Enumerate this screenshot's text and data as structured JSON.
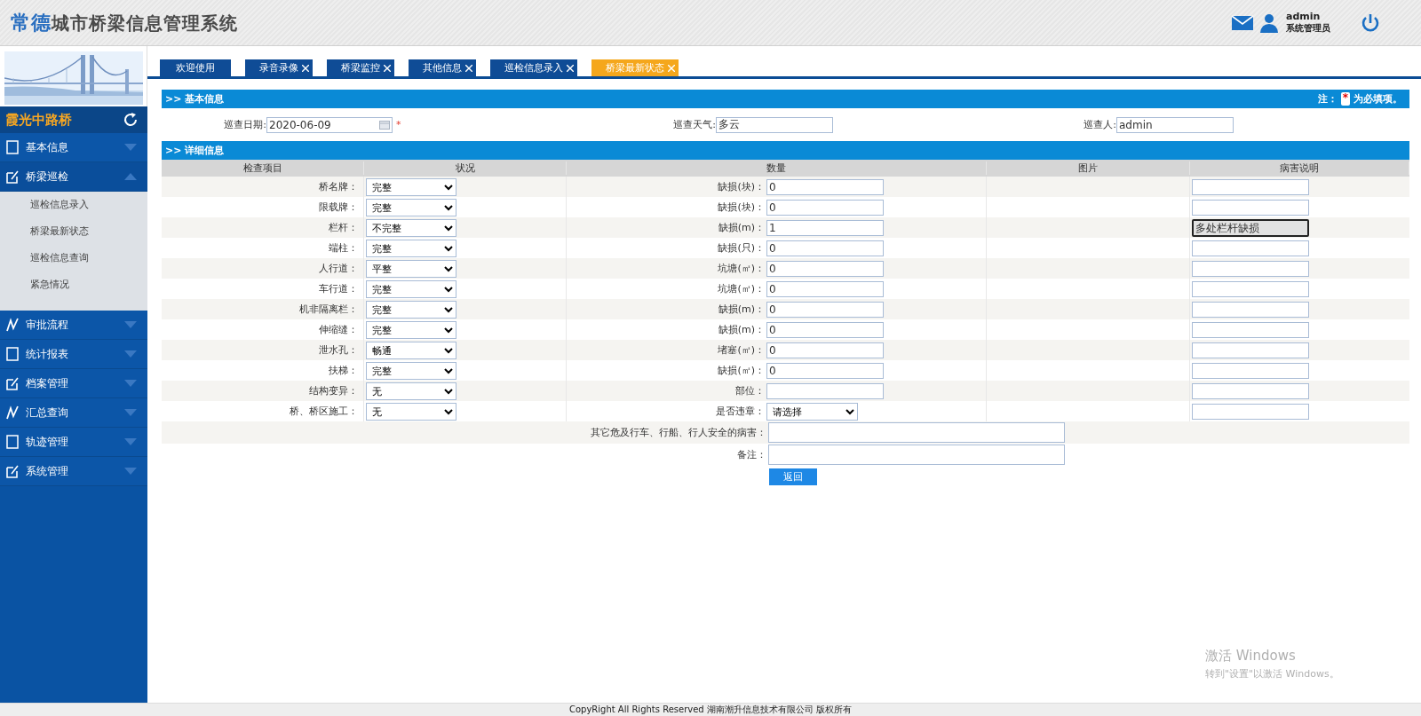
{
  "header": {
    "logo_city": "常德",
    "logo_rest": "城市桥梁信息管理系统",
    "user": {
      "name": "admin",
      "role": "系统管理员"
    }
  },
  "sidebar": {
    "bridge_name": "霞光中路桥",
    "menu": [
      {
        "label": "基本信息",
        "expanded": false
      },
      {
        "label": "桥梁巡检",
        "expanded": true,
        "children": [
          {
            "label": "巡检信息录入",
            "selected": false
          },
          {
            "label": "桥梁最新状态",
            "selected": false
          },
          {
            "label": "巡检信息查询",
            "selected": false
          },
          {
            "label": "紧急情况",
            "selected": false
          }
        ]
      },
      {
        "label": "审批流程",
        "expanded": false
      },
      {
        "label": "统计报表",
        "expanded": false
      },
      {
        "label": "档案管理",
        "expanded": false
      },
      {
        "label": "汇总查询",
        "expanded": false
      },
      {
        "label": "轨迹管理",
        "expanded": false
      },
      {
        "label": "系统管理",
        "expanded": false
      }
    ]
  },
  "tabs": [
    {
      "label": "欢迎使用",
      "selected": false,
      "closable": false
    },
    {
      "label": "录音录像",
      "selected": false,
      "closable": true
    },
    {
      "label": "桥梁监控",
      "selected": false,
      "closable": true
    },
    {
      "label": "其他信息",
      "selected": false,
      "closable": true
    },
    {
      "label": "巡检信息录入",
      "selected": false,
      "closable": true
    },
    {
      "label": "桥梁最新状态",
      "selected": true,
      "closable": true
    }
  ],
  "basic_info": {
    "title": ">> 基本信息",
    "note_prefix": "注：",
    "required_mark": "*",
    "note_suffix": "为必填项。",
    "fields": [
      {
        "label": "巡查日期:",
        "value": "2020-06-09",
        "kind": "date",
        "required": true
      },
      {
        "label": "巡查天气:",
        "value": "多云",
        "kind": "text"
      },
      {
        "label": "巡查人:",
        "value": "admin",
        "kind": "text"
      }
    ]
  },
  "detail": {
    "title": ">> 详细信息",
    "columns": [
      "检查项目",
      "状况",
      "数量",
      "图片",
      "病害说明"
    ],
    "rows": [
      {
        "item": "桥名牌：",
        "status": "完整",
        "quantity_label": "缺损(块)：",
        "quantity": {
          "kind": "input",
          "value": "0"
        },
        "focused": false
      },
      {
        "item": "限载牌：",
        "status": "完整",
        "quantity_label": "缺损(块)：",
        "quantity": {
          "kind": "input",
          "value": "0"
        },
        "focused": false
      },
      {
        "item": "栏杆：",
        "status": "不完整",
        "quantity_label": "缺损(m)：",
        "quantity": {
          "kind": "input",
          "value": "1"
        },
        "description": "多处栏杆缺损",
        "focused": true
      },
      {
        "item": "端柱：",
        "status": "完整",
        "quantity_label": "缺损(只)：",
        "quantity": {
          "kind": "input",
          "value": "0"
        },
        "focused": false
      },
      {
        "item": "人行道：",
        "status": "平整",
        "quantity_label": "坑塘(㎡)：",
        "quantity": {
          "kind": "input",
          "value": "0"
        },
        "focused": false
      },
      {
        "item": "车行道：",
        "status": "完整",
        "quantity_label": "坑塘(㎡)：",
        "quantity": {
          "kind": "input",
          "value": "0"
        },
        "focused": false
      },
      {
        "item": "机非隔离栏：",
        "status": "完整",
        "quantity_label": "缺损(m)：",
        "quantity": {
          "kind": "input",
          "value": "0"
        },
        "focused": false
      },
      {
        "item": "伸缩缝：",
        "status": "完整",
        "quantity_label": "缺损(m)：",
        "quantity": {
          "kind": "input",
          "value": "0"
        },
        "focused": false
      },
      {
        "item": "泄水孔：",
        "status": "畅通",
        "quantity_label": "堵塞(㎡)：",
        "quantity": {
          "kind": "input",
          "value": "0"
        },
        "focused": false
      },
      {
        "item": "扶梯：",
        "status": "完整",
        "quantity_label": "缺损(㎡)：",
        "quantity": {
          "kind": "input",
          "value": "0"
        },
        "focused": false
      },
      {
        "item": "结构变异：",
        "status": "无",
        "quantity_label": "部位：",
        "quantity": {
          "kind": "input"
        },
        "focused": false
      },
      {
        "item": "桥、桥区施工：",
        "status": "无",
        "quantity_label": "是否违章：",
        "quantity": {
          "kind": "select",
          "value": "请选择"
        },
        "focused": false
      }
    ],
    "extra_rows": [
      {
        "label": "其它危及行车、行船、行人安全的病害："
      },
      {
        "label": "备注："
      }
    ],
    "back_button": "返回"
  },
  "footer": "CopyRight All Rights Reserved 湖南潮升信息技术有限公司 版权所有",
  "os_notice": {
    "title": "激活 Windows",
    "hint": "转到\"设置\"以激活 Windows。"
  }
}
